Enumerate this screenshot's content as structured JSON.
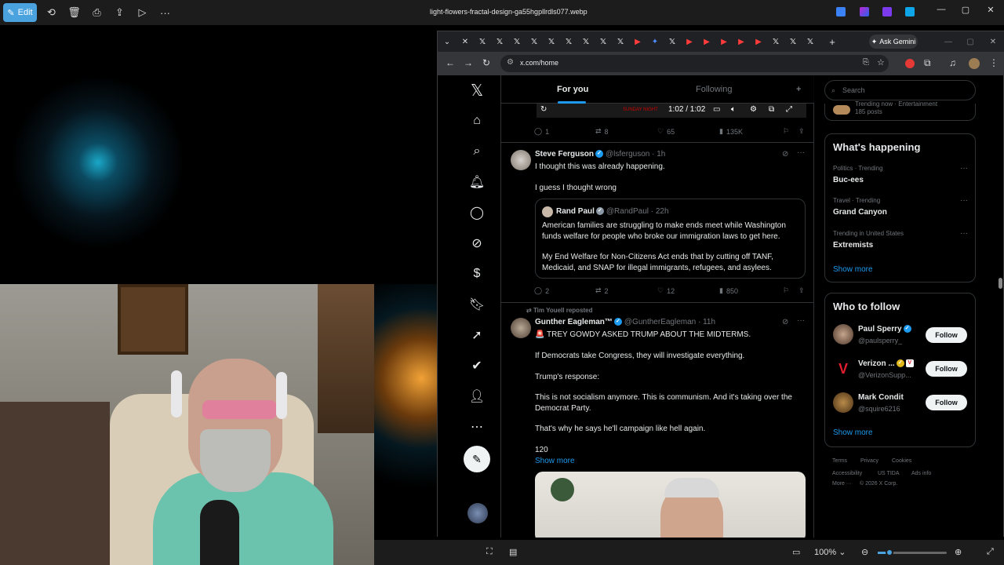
{
  "photos_app": {
    "edit_label": "Edit",
    "filename": "light-flowers-fractal-design-ga55hgpllrdls077.webp",
    "zoom": "100%",
    "window_controls": {
      "minimize": "—",
      "maximize": "▢",
      "close": "✕"
    }
  },
  "browser": {
    "gemini_label": "Ask Gemini",
    "url": "x.com/home",
    "new_tab": "+"
  },
  "x": {
    "tabs": {
      "for_you": "For you",
      "following": "Following"
    },
    "video": {
      "time": "1:02 / 1:02",
      "overlay": "SUNDAY NIGHT"
    },
    "tweet0_actions": {
      "replies": "1",
      "retweets": "8",
      "likes": "65",
      "views": "135K"
    },
    "tweet1": {
      "name": "Steve Ferguson",
      "handle": "@lsferguson · 1h",
      "line1": "I thought this was already happening.",
      "line2": "I guess I thought wrong",
      "quote": {
        "name": "Rand Paul",
        "handle": "@RandPaul · 22h",
        "para1": "American families are struggling to make ends meet while Washington funds welfare for people who broke our immigration laws to get here.",
        "para2": "My End Welfare for Non-Citizens Act ends that by cutting off TANF, Medicaid, and SNAP for illegal immigrants, refugees, and asylees."
      },
      "actions": {
        "replies": "2",
        "retweets": "2",
        "likes": "12",
        "views": "850"
      }
    },
    "tweet2": {
      "reposted_by": "Tim Youell reposted",
      "name": "Gunther Eagleman™",
      "handle": "@GuntherEagleman · 11h",
      "line1": "🚨 TREY GOWDY ASKED TRUMP ABOUT THE MIDTERMS.",
      "line2": "If Democrats take Congress, they will investigate everything.",
      "line3": "Trump's response:",
      "line4": "This is not socialism anymore. This is communism. And it's taking over the Democrat Party.",
      "line5": "That's why he says he'll campaign like hell again.",
      "line6": "120",
      "show_more": "Show more"
    },
    "right": {
      "search_placeholder": "Search",
      "top_snippet": "Trending now · Entertainment",
      "top_posts": "185 posts",
      "whats_happening": "What's happening",
      "trends": [
        {
          "meta": "Politics · Trending",
          "name": "Buc-ees"
        },
        {
          "meta": "Travel · Trending",
          "name": "Grand Canyon"
        },
        {
          "meta": "Trending in United States",
          "name": "Extremists"
        }
      ],
      "show_more": "Show more",
      "who_to_follow": "Who to follow",
      "follow_label": "Follow",
      "accounts": [
        {
          "name": "Paul Sperry",
          "handle": "@paulsperry_"
        },
        {
          "name": "Verizon ...",
          "handle": "@VerizonSupp..."
        },
        {
          "name": "Mark Condit",
          "handle": "@squire6216"
        }
      ],
      "footer": [
        "Terms",
        "Privacy",
        "Cookies",
        "Accessibility",
        "US TIDA",
        "Ads info",
        "More ···",
        "© 2026 X Corp."
      ]
    }
  },
  "colors": {
    "accent": "#1d9bf0",
    "edit_button": "#4aa3df",
    "border": "#2f3336"
  }
}
